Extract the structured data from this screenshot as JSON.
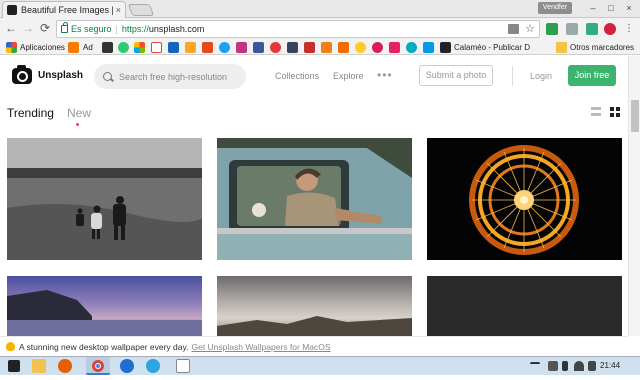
{
  "browser": {
    "tab_title": "Beautiful Free Images | U",
    "tab_close": "×",
    "user_chip": "Vendfer",
    "window_controls": [
      "–",
      "□",
      "×"
    ],
    "nav": {
      "back": "←",
      "forward": "→",
      "reload": "⟳"
    },
    "omnibox": {
      "secure_label": "Es seguro",
      "separator": "|",
      "url_scheme": "https://",
      "url_host": "unsplash.com",
      "star": "☆"
    },
    "bookmarks": {
      "apps_label": "Aplicaciones",
      "ad_label": "Ad",
      "calameo_label": "Calaméo - Publicar D",
      "other_label": "Otros marcadores"
    }
  },
  "site": {
    "brand": "Unsplash",
    "search_placeholder": "Search free high-resolution",
    "nav": {
      "collections": "Collections",
      "explore": "Explore",
      "more": "•••"
    },
    "submit_label": "Submit a photo",
    "login_label": "Login",
    "join_label": "Join free",
    "tabs": {
      "trending": "Trending",
      "new": "New"
    },
    "notice": {
      "text": "A stunning new desktop wallpaper every day.",
      "link": "Get Unsplash Wallpapers for MacOS"
    }
  },
  "taskbar": {
    "clock": "21:44"
  },
  "colors": {
    "accent_green": "#3cb46e",
    "secure_green": "#0b8043",
    "notice_badge": "#f5b400"
  }
}
